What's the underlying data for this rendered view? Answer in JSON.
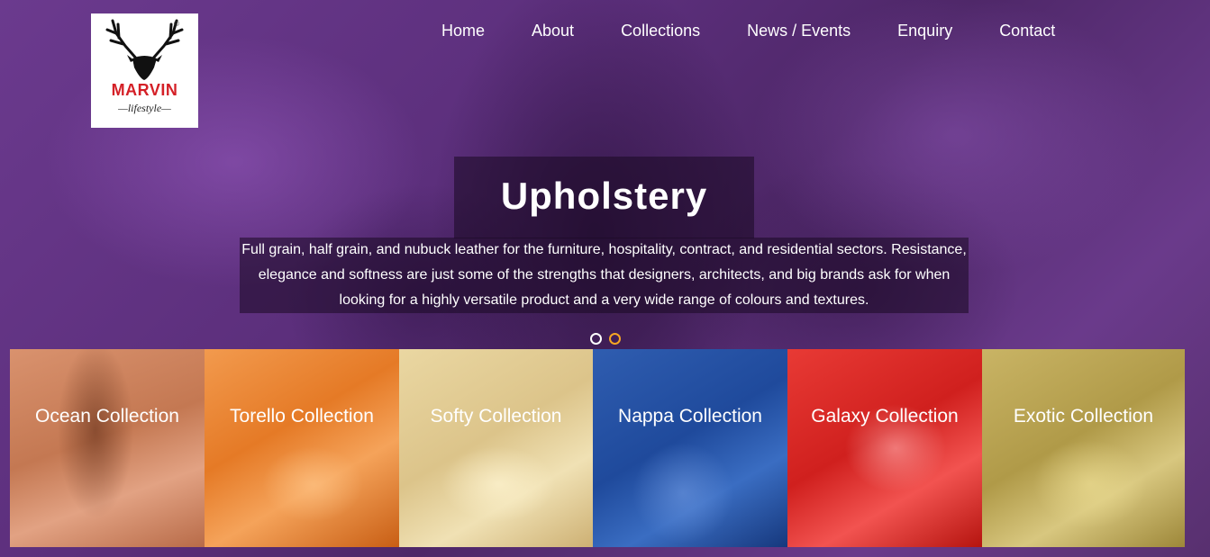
{
  "brand": {
    "name": "MARVIN",
    "tagline": "lifestyle",
    "registered": "®"
  },
  "nav": {
    "items": [
      "Home",
      "About",
      "Collections",
      "News / Events",
      "Enquiry",
      "Contact"
    ]
  },
  "hero": {
    "title": "Upholstery",
    "description": "Full grain, half grain, and nubuck leather for the furniture, hospitality, contract, and residential sectors. Resistance, elegance and softness are just some of the strengths that designers, architects, and big brands ask for when looking for a highly versatile product and a very wide range of colours and textures.",
    "slides_total": 2,
    "active_slide": 2
  },
  "collections": [
    {
      "label": "Ocean Collection",
      "color": "#c47852"
    },
    {
      "label": "Torello Collection",
      "color": "#e57a26"
    },
    {
      "label": "Softy Collection",
      "color": "#dcc48a"
    },
    {
      "label": "Nappa Collection",
      "color": "#1f4a9c"
    },
    {
      "label": "Galaxy Collection",
      "color": "#d0201e"
    },
    {
      "label": "Exotic Collection",
      "color": "#b09a48"
    }
  ],
  "colors": {
    "background": "#5a2f78",
    "brand_red": "#d42027",
    "dot_active": "#f5a623"
  },
  "icons": {
    "logo": "stag-head-icon"
  }
}
